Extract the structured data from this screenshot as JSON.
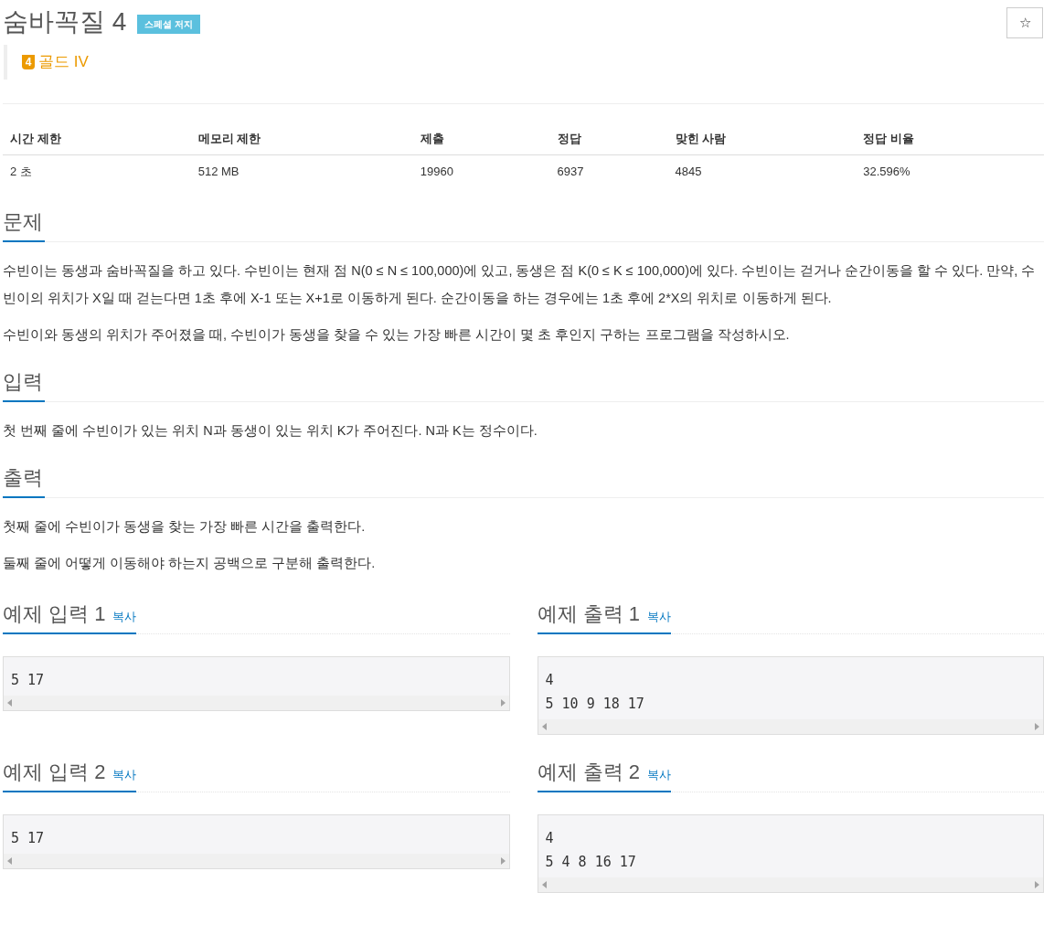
{
  "title": "숨바꼭질 4",
  "badge": "스페셜 저지",
  "star": "☆",
  "tier": {
    "number": "4",
    "label": "골드 IV"
  },
  "table": {
    "columns": [
      "시간 제한",
      "메모리 제한",
      "제출",
      "정답",
      "맞힌 사람",
      "정답 비율"
    ],
    "rows": [
      [
        "2 초",
        "512 MB",
        "19960",
        "6937",
        "4845",
        "32.596%"
      ]
    ]
  },
  "sections": [
    {
      "heading": "문제",
      "paragraphs": [
        "수빈이는 동생과 숨바꼭질을 하고 있다. 수빈이는 현재 점 N(0 ≤ N ≤ 100,000)에 있고, 동생은 점 K(0 ≤ K ≤ 100,000)에 있다. 수빈이는 걷거나 순간이동을 할 수 있다. 만약, 수빈이의 위치가 X일 때 걷는다면 1초 후에 X-1 또는 X+1로 이동하게 된다. 순간이동을 하는 경우에는 1초 후에 2*X의 위치로 이동하게 된다.",
        "수빈이와 동생의 위치가 주어졌을 때, 수빈이가 동생을 찾을 수 있는 가장 빠른 시간이 몇 초 후인지 구하는 프로그램을 작성하시오."
      ]
    },
    {
      "heading": "입력",
      "paragraphs": [
        "첫 번째 줄에 수빈이가 있는 위치 N과 동생이 있는 위치 K가 주어진다. N과 K는 정수이다."
      ]
    },
    {
      "heading": "출력",
      "paragraphs": [
        "첫째 줄에 수빈이가 동생을 찾는 가장 빠른 시간을 출력한다.",
        "둘째 줄에 어떻게 이동해야 하는지 공백으로 구분해 출력한다."
      ]
    }
  ],
  "samples": [
    {
      "input": {
        "heading": "예제 입력 1",
        "copy": "복사",
        "lines": [
          "5 17"
        ]
      },
      "output": {
        "heading": "예제 출력 1",
        "copy": "복사",
        "lines": [
          "4",
          "5 10 9 18 17"
        ]
      }
    },
    {
      "input": {
        "heading": "예제 입력 2",
        "copy": "복사",
        "lines": [
          "5 17"
        ]
      },
      "output": {
        "heading": "예제 출력 2",
        "copy": "복사",
        "lines": [
          "4",
          "5 4 8 16 17"
        ]
      }
    }
  ]
}
